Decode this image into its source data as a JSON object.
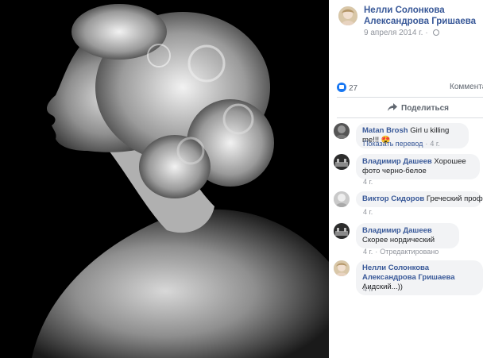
{
  "post": {
    "author": "Нелли Солонкова Александрова Гришаева",
    "date": "9 апреля 2014 г.",
    "likes": "27",
    "comments_label": "Комментарии",
    "share_label": "Поделиться"
  },
  "comments": [
    {
      "name": "Matan Brosh",
      "text": "Girl u killing me!!! 😍",
      "extra": "Показать перевод",
      "time": "4 г."
    },
    {
      "name": "Владимир Дашеев",
      "text": "Хорошее фото черно-белое",
      "time": "4 г."
    },
    {
      "name": "Виктор Сидоров",
      "text": "Греческий профиль))",
      "time": "4 г."
    },
    {
      "name": "Владимир Дашеев",
      "text": "Скорее нордический",
      "time": "4 г.",
      "extra": "Отредактировано"
    },
    {
      "name": "Нелли Солонкова Александрова Гришаева",
      "text": "Аидский...))",
      "time": "4 г."
    }
  ],
  "colors": {
    "link": "#385898",
    "muted": "#90949c",
    "bubble": "#f2f3f5",
    "like": "#1877f2"
  }
}
